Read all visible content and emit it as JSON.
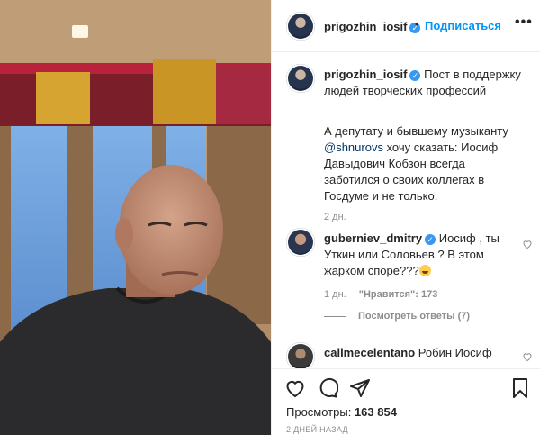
{
  "post": {
    "author": "prigozhin_iosif",
    "follow_label": "Подписаться",
    "separator": "•",
    "more_label": "•••",
    "caption_lines": [
      "Пост в поддержку",
      "людей творческих профессий"
    ],
    "caption2_pre": "А депутату и бывшему музыканту",
    "caption2_mention": "@shnurovs",
    "caption2_rest": " хочу сказать: Иосиф Давыдович Кобзон всегда заботился о своих коллегах в Госдуме и не только.",
    "caption_time": "2 дн."
  },
  "comments": [
    {
      "author": "guberniev_dmitry",
      "text": "Иосиф , ты Уткин или Соловьев ? В этом жарком споре???",
      "time": "1 дн.",
      "likes": "\"Нравится\": 173",
      "replies": "Посмотреть ответы (7)"
    },
    {
      "author": "callmecelentano",
      "text": "Робин Иосиф"
    }
  ],
  "stats": {
    "views_label": "Просмотры:",
    "views_count": "163 854",
    "date": "2 ДНЕЙ НАЗАД"
  },
  "icons": {
    "like": "heart-icon",
    "comment": "comment-icon",
    "share": "share-icon",
    "save": "bookmark-icon"
  },
  "colors": {
    "link": "#0095f6",
    "verified": "#3897f0",
    "muted": "#8e8e8e"
  }
}
